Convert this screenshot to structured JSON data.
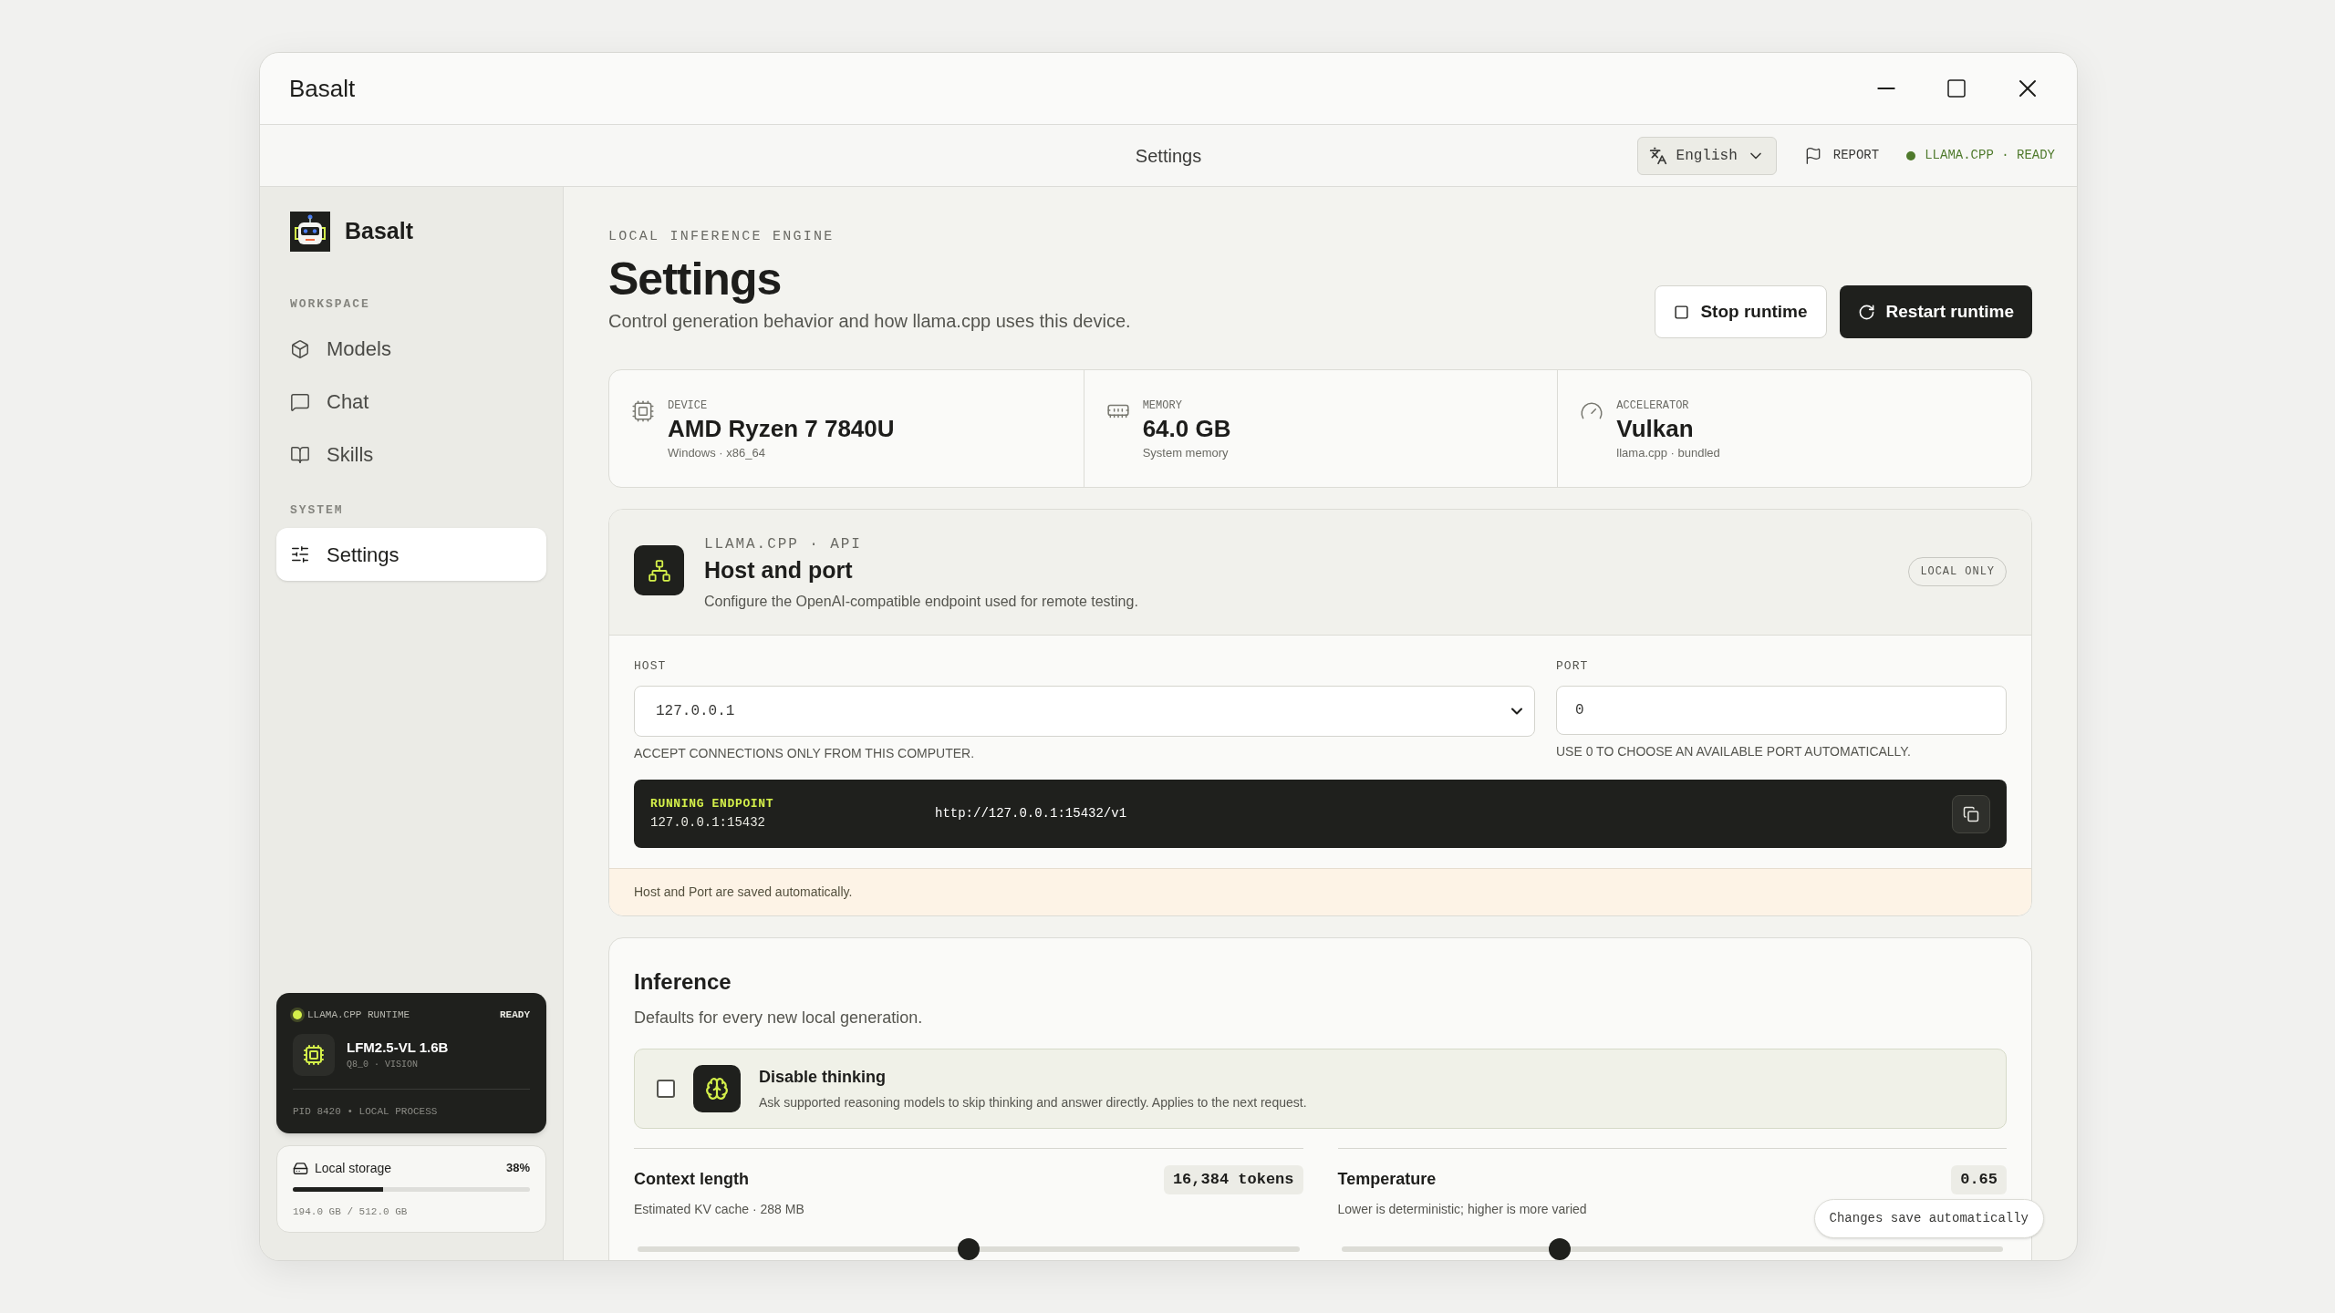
{
  "window": {
    "title": "Basalt"
  },
  "header": {
    "title": "Settings",
    "language": "English",
    "report": "REPORT",
    "status": "LLAMA.CPP · READY"
  },
  "sidebar": {
    "brand": "Basalt",
    "sections": [
      {
        "label": "WORKSPACE",
        "items": [
          {
            "label": "Models",
            "selected": false
          },
          {
            "label": "Chat",
            "selected": false
          },
          {
            "label": "Skills",
            "selected": false
          }
        ]
      },
      {
        "label": "SYSTEM",
        "items": [
          {
            "label": "Settings",
            "selected": true
          }
        ]
      }
    ]
  },
  "runtime_card": {
    "label": "LLAMA.CPP RUNTIME",
    "status": "READY",
    "model": "LFM2.5-VL 1.6B",
    "meta": "Q8_0 · VISION",
    "footer": "PID 8420 • LOCAL PROCESS"
  },
  "storage": {
    "label": "Local storage",
    "percent": "38%",
    "level": 0.38,
    "usage": "194.0 GB / 512.0 GB"
  },
  "page": {
    "eyebrow": "LOCAL INFERENCE ENGINE",
    "title": "Settings",
    "description": "Control generation behavior and how llama.cpp uses this device.",
    "buttons": [
      {
        "label": "Stop runtime",
        "kind": "secondary"
      },
      {
        "label": "Restart runtime",
        "kind": "primary"
      }
    ]
  },
  "stats": [
    {
      "label": "DEVICE",
      "value": "AMD Ryzen 7 7840U",
      "detail": "Windows · x86_64"
    },
    {
      "label": "MEMORY",
      "value": "64.0 GB",
      "detail": "System memory"
    },
    {
      "label": "ACCELERATOR",
      "value": "Vulkan",
      "detail": "llama.cpp · bundled"
    }
  ],
  "host_panel": {
    "eyebrow": "LLAMA.CPP · API",
    "title": "Host and port",
    "description": "Configure the OpenAI-compatible endpoint used for remote testing.",
    "badge": "LOCAL ONLY",
    "host": {
      "label": "HOST",
      "value": "127.0.0.1",
      "hint": "ACCEPT CONNECTIONS ONLY FROM THIS COMPUTER."
    },
    "port": {
      "label": "PORT",
      "value": "0",
      "hint": "USE 0 TO CHOOSE AN AVAILABLE PORT AUTOMATICALLY."
    },
    "endpoint": {
      "label": "RUNNING ENDPOINT",
      "address": "127.0.0.1:15432",
      "url": "http://127.0.0.1:15432/v1"
    },
    "note": "Host and Port are saved automatically."
  },
  "inference": {
    "title": "Inference",
    "description": "Defaults for every new local generation.",
    "toggle": {
      "label": "Disable thinking",
      "description": "Ask supported reasoning models to skip thinking and answer directly. Applies to the next request.",
      "checked": false
    },
    "sliders": [
      {
        "label": "Context length",
        "reading": "16,384 tokens",
        "detail": "Estimated KV cache · 288 MB",
        "level": 0.5
      },
      {
        "label": "Temperature",
        "reading": "0.65",
        "detail": "Lower is deterministic; higher is more varied",
        "level": 0.33
      }
    ]
  },
  "toast": "Changes save automatically"
}
